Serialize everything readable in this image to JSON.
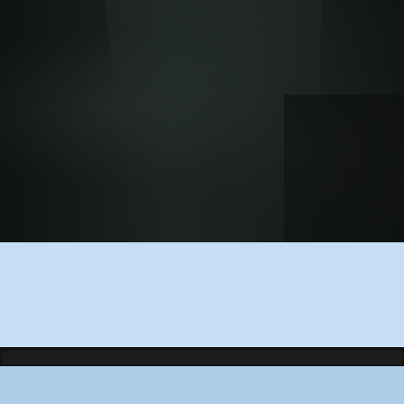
{
  "colors": {
    "video_background": "#151b18",
    "panel_top": "#c8def5",
    "separator_bar": "#1c1c1c",
    "panel_bottom": "#aecde8"
  }
}
